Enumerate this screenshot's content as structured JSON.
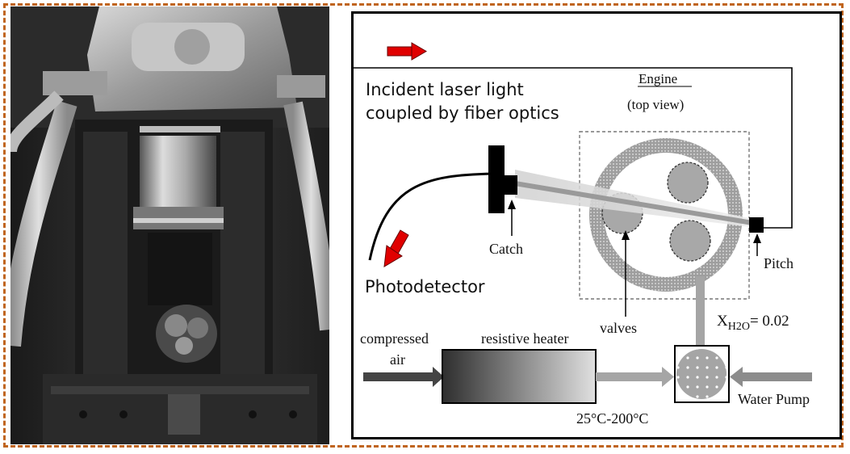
{
  "photo": {
    "alt": "engine test rig photograph"
  },
  "diagram": {
    "incident_line1": "Incident laser light",
    "incident_line2": "coupled by fiber optics",
    "engine_title": "Engine",
    "engine_subtitle": "(top view)",
    "catch": "Catch",
    "pitch": "Pitch",
    "photodetector": "Photodetector",
    "valves": "valves",
    "x_h2o_symbol": "X",
    "x_h2o_sub": "H2O",
    "x_h2o_value": "= 0.02",
    "compressed_air_line1": "compressed",
    "compressed_air_line2": "air",
    "resistive_heater": "resistive heater",
    "temperature_range": "25°C-200°C",
    "water_pump": "Water Pump",
    "arrow_color": "#e00000",
    "frame_color": "#c0651f"
  }
}
